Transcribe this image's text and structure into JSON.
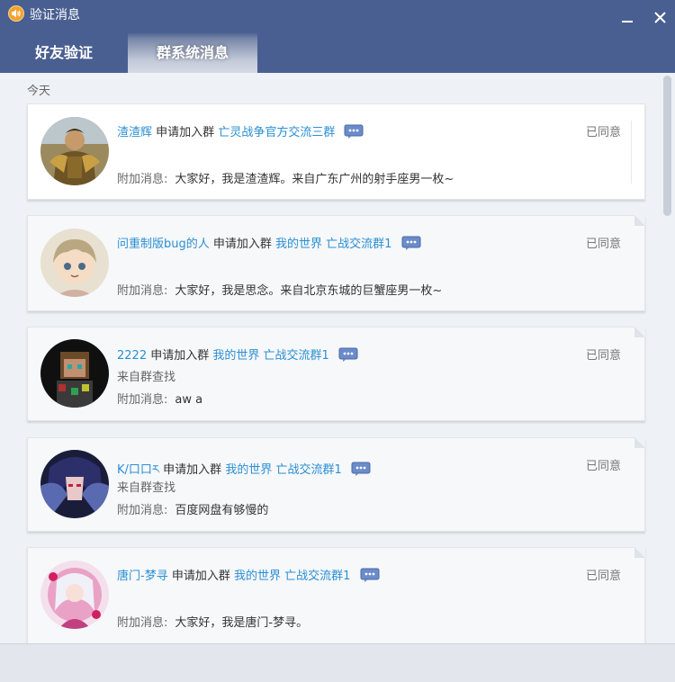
{
  "window": {
    "title": "验证消息",
    "minimize_icon": "minimize-icon",
    "close_icon": "close-icon"
  },
  "tabs": [
    {
      "label": "好友验证",
      "active": false
    },
    {
      "label": "群系统消息",
      "active": true
    }
  ],
  "section": {
    "label": "今天"
  },
  "requests": [
    {
      "name": "渣渣辉",
      "action": "申请加入群",
      "group": "亡灵战争官方交流三群",
      "status": "已同意",
      "from": "",
      "message_label": "附加消息:",
      "message": "大家好，我是渣渣辉。来自广东广州的射手座男一枚~"
    },
    {
      "name": "问重制版bug的人",
      "action": "申请加入群",
      "group": "我的世界 亡战交流群1",
      "status": "已同意",
      "from": "",
      "message_label": "附加消息:",
      "message": "大家好，我是思念。来自北京东城的巨蟹座男一枚~"
    },
    {
      "name": "2222",
      "action": "申请加入群",
      "group": "我的世界 亡战交流群1",
      "status": "已同意",
      "from": "来自群查找",
      "message_label": "附加消息:",
      "message": "aw a"
    },
    {
      "name": "K/口口ར",
      "action": "申请加入群",
      "group": "我的世界 亡战交流群1",
      "status": "已同意",
      "from": "来自群查找",
      "message_label": "附加消息:",
      "message": "百度网盘有够慢的"
    },
    {
      "name": "唐门-梦寻",
      "action": "申请加入群",
      "group": "我的世界 亡战交流群1",
      "status": "已同意",
      "from": "",
      "message_label": "附加消息:",
      "message": "大家好，我是唐门-梦寻。"
    }
  ],
  "colors": {
    "titlebar": "#4a5f91",
    "link": "#2a8fd4",
    "content_bg": "#eef1f5"
  }
}
